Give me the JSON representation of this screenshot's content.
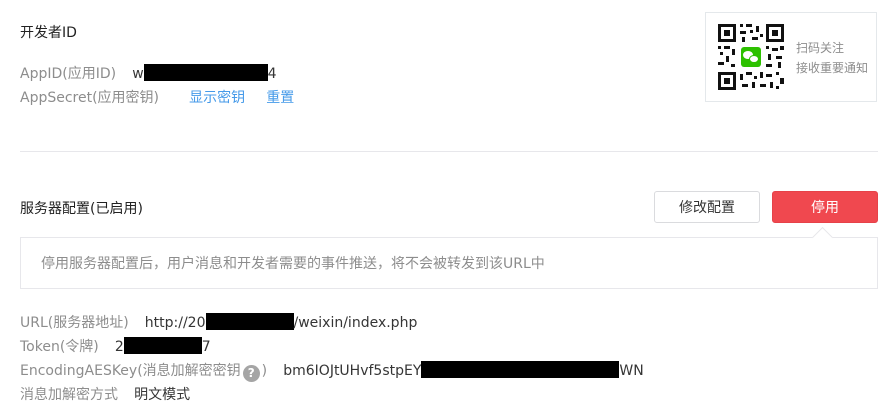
{
  "developer": {
    "title": "开发者ID",
    "appid_label": "AppID(应用ID)",
    "appid_prefix": "w",
    "appid_suffix": "4",
    "secret_label": "AppSecret(应用密钥)",
    "show_secret": "显示密钥",
    "reset": "重置"
  },
  "qr": {
    "line1": "扫码关注",
    "line2": "接收重要通知"
  },
  "server": {
    "title": "服务器配置(已启用)",
    "modify_button": "修改配置",
    "disable_button": "停用",
    "tip": "停用服务器配置后，用户消息和开发者需要的事件推送，将不会被转发到该URL中",
    "url_label": "URL(服务器地址)",
    "url_prefix": "http://20",
    "url_suffix": "/weixin/index.php",
    "token_label": "Token(令牌)",
    "token_prefix": "2",
    "token_suffix": "7",
    "aes_label": "EncodingAESKey(消息加解密密钥",
    "aes_help": "?",
    "aes_label_close": ")",
    "aes_prefix": "bm6IOJtUHvf5stpEY",
    "aes_suffix": "WN",
    "mode_label": "消息加解密方式",
    "mode_value": "明文模式"
  },
  "colors": {
    "link": "#459ae9",
    "danger": "#f0484f",
    "label": "#8d8d8d",
    "wechat_green": "#2dc100"
  },
  "icons": [
    "qr-code-icon",
    "wechat-icon",
    "help-circle-icon"
  ]
}
